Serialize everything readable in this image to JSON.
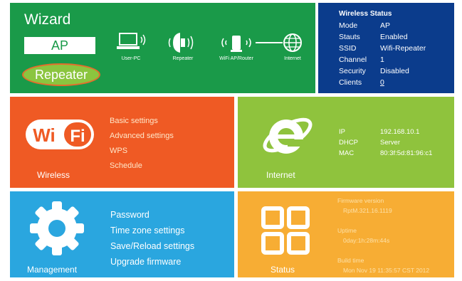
{
  "wizard": {
    "title": "Wizard",
    "modes": {
      "ap": "AP",
      "repeater": "Repeater"
    },
    "devices": [
      {
        "label": "User-PC"
      },
      {
        "label": "Repeater"
      },
      {
        "label": "WiFi AP/Router"
      },
      {
        "label": "Internet"
      }
    ]
  },
  "wireless_status": {
    "title": "Wireless Status",
    "rows": [
      {
        "key": "Mode",
        "value": "AP"
      },
      {
        "key": "Stauts",
        "value": "Enabled"
      },
      {
        "key": "SSID",
        "value": "Wifi-Repeater"
      },
      {
        "key": "Channel",
        "value": "1"
      },
      {
        "key": "Security",
        "value": "Disabled"
      },
      {
        "key": "Clients",
        "value": "0"
      }
    ]
  },
  "wireless": {
    "logo_text": "Wi Fi",
    "caption": "Wireless",
    "menu": [
      "Basic settings",
      "Advanced settings",
      "WPS",
      "Schedule"
    ]
  },
  "internet": {
    "caption": "Internet",
    "rows": [
      {
        "key": "IP",
        "value": "192.168.10.1"
      },
      {
        "key": "DHCP",
        "value": "Server"
      },
      {
        "key": "MAC",
        "value": "80:3f:5d:81:96:c1"
      }
    ]
  },
  "management": {
    "caption": "Management",
    "menu": [
      "Password",
      "Time zone settings",
      "Save/Reload settings",
      "Upgrade firmware"
    ]
  },
  "status": {
    "caption": "Status",
    "firmware_label": "Firmware version",
    "firmware_value": "RptM.321.16.1119",
    "uptime_label": "Uptime",
    "uptime_value": "0day:1h:28m:44s",
    "build_label": "Build time",
    "build_value": "Mon Nov 19 11:35:57 CST 2012"
  },
  "colors": {
    "wizard": "#1a9a49",
    "wireless_status": "#0b3c8c",
    "wireless": "#ef5a24",
    "internet": "#8fc33d",
    "management": "#2aa6df",
    "status": "#f7ad34"
  }
}
